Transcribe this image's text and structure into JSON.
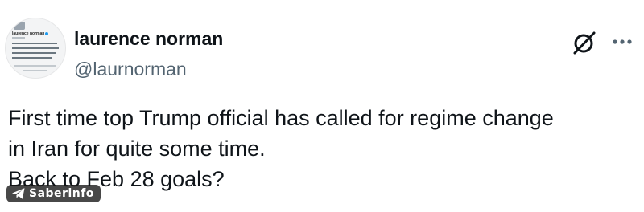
{
  "author": {
    "display_name": "laurence norman",
    "handle": "@laurnorman",
    "avatar": {
      "name": "laurence norman",
      "icon": "verified-badge-icon"
    }
  },
  "actions": {
    "grok_icon": "grok-icon",
    "more_icon": "more-dots-icon"
  },
  "tweet": {
    "lines": [
      "First time top Trump official has called for regime change",
      "in Iran for quite some time.",
      "Back to Feb 28 goals?"
    ]
  },
  "watermark": {
    "text": "Saberinfo",
    "icon": "telegram-icon",
    "logo_lettering": "@Saberinfo"
  },
  "colors": {
    "text": "#0f1419",
    "secondary": "#536471",
    "verified": "#1d9bf0",
    "watermark_bg": "#141414"
  }
}
